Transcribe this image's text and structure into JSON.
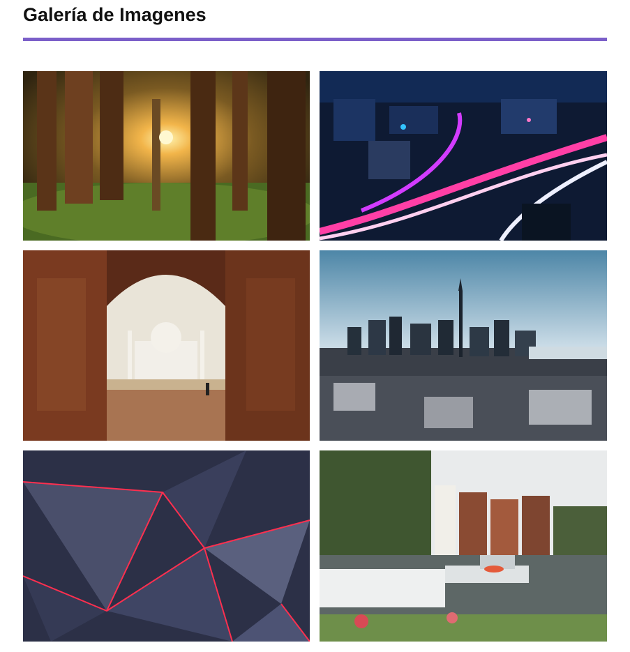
{
  "gallery": {
    "title": "Galería de Imagenes",
    "accent_color": "#7b5fc9",
    "images": [
      {
        "subject": "redwood-forest-sunlight"
      },
      {
        "subject": "neon-city-night-traffic"
      },
      {
        "subject": "taj-mahal-through-archway"
      },
      {
        "subject": "toronto-skyline-winter"
      },
      {
        "subject": "geometric-triangles-red-glow"
      },
      {
        "subject": "amsterdam-canal-houseboats"
      }
    ]
  }
}
